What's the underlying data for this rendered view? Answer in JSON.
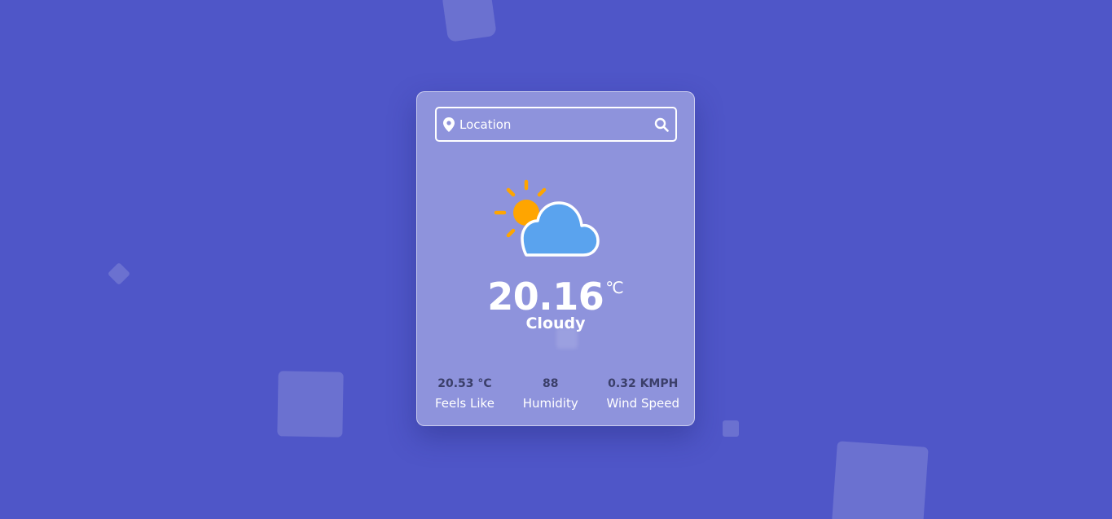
{
  "search": {
    "placeholder": "Location",
    "value": ""
  },
  "weather": {
    "icon": "partly-cloudy-icon",
    "temperature": "20.16",
    "unit": "℃",
    "condition": "Cloudy"
  },
  "stats": [
    {
      "value": "20.53 °C",
      "label": "Feels Like"
    },
    {
      "value": "88",
      "label": "Humidity"
    },
    {
      "value": "0.32 KMPH",
      "label": "Wind Speed"
    }
  ],
  "colors": {
    "background": "#4f56c8",
    "sun": "#ffa500",
    "cloud": "#5aa3ee"
  }
}
